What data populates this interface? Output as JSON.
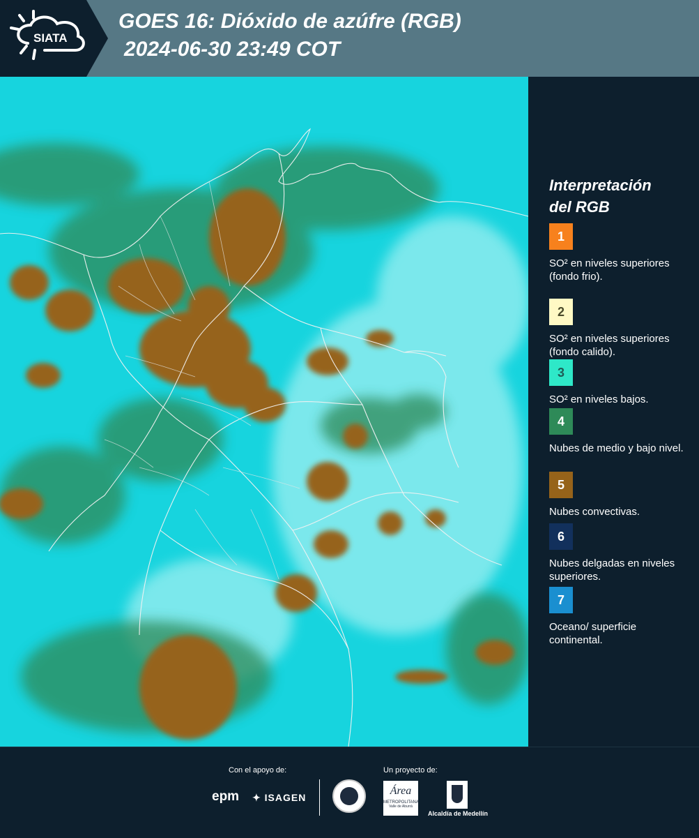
{
  "header": {
    "brand": "SIATA",
    "title_line1": "GOES 16: Dióxido de azúfre (RGB)",
    "title_line2": "2024-06-30 23:49 COT"
  },
  "legend": {
    "title_line1": "Interpretación",
    "title_line2": "del RGB",
    "items": [
      {
        "number": "1",
        "color": "#f7811d",
        "number_color": "#ffffff",
        "text": "SO² en niveles superiores (fondo frio)."
      },
      {
        "number": "2",
        "color": "#fff9c4",
        "number_color": "#4a4a2a",
        "text": "SO² en niveles superiores (fondo calido)."
      },
      {
        "number": "3",
        "color": "#2ee8c8",
        "number_color": "#1f5c55",
        "text": "SO² en niveles bajos."
      },
      {
        "number": "4",
        "color": "#2e8a58",
        "number_color": "#ffffff",
        "text": "Nubes de medio y bajo nivel."
      },
      {
        "number": "5",
        "color": "#96631a",
        "number_color": "#ffffff",
        "text": "Nubes convectivas."
      },
      {
        "number": "6",
        "color": "#12305c",
        "number_color": "#ffffff",
        "text": "Nubes delgadas en niveles superiores."
      },
      {
        "number": "7",
        "color": "#1a8fd0",
        "number_color": "#ffffff",
        "text": "Oceano/ superficie continental."
      }
    ]
  },
  "footer": {
    "support_label": "Con el apoyo de:",
    "project_label": "Un proyecto de:",
    "sponsor1": "epm",
    "sponsor2": "ISAGEN",
    "partner_area": "Área",
    "partner_area_sub1": "METROPOLITANA",
    "partner_area_sub2": "Valle de Aburrá",
    "partner_alcaldia": "Alcaldía de Medellín"
  },
  "colors": {
    "header_bg": "#567885",
    "header_dark": "#0d1f2d",
    "map_cyan": "#17d4de",
    "convective_brown": "#96631a",
    "mid_low_green": "#2e8a58"
  }
}
